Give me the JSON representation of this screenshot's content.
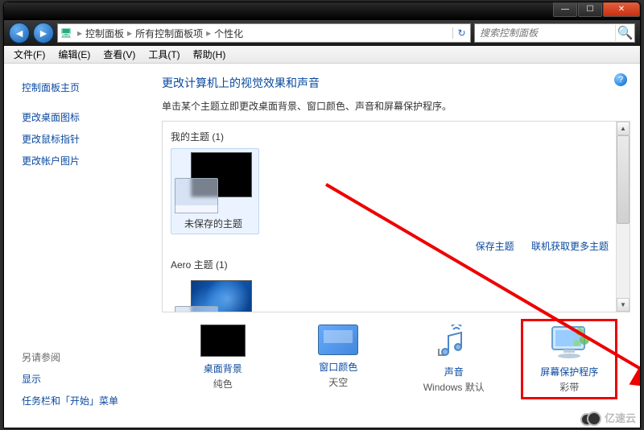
{
  "titlebar": {
    "min_glyph": "—",
    "max_glyph": "☐",
    "close_glyph": "✕"
  },
  "nav": {
    "back_glyph": "◄",
    "fwd_glyph": "►"
  },
  "breadcrumb": {
    "root": "控制面板",
    "mid": "所有控制面板项",
    "leaf": "个性化",
    "sep": "▸",
    "icon": "🖥",
    "refresh_glyph": "↻"
  },
  "search": {
    "placeholder": "搜索控制面板",
    "glyph": "🔍"
  },
  "menubar": {
    "file": "文件(F)",
    "edit": "编辑(E)",
    "view": "查看(V)",
    "tools": "工具(T)",
    "help": "帮助(H)"
  },
  "sidebar": {
    "home": "控制面板主页",
    "items": [
      "更改桌面图标",
      "更改鼠标指针",
      "更改帐户图片"
    ],
    "seealso_h": "另请参阅",
    "seealso": [
      "显示",
      "任务栏和「开始」菜单"
    ]
  },
  "main": {
    "title": "更改计算机上的视觉效果和声音",
    "desc": "单击某个主题立即更改桌面背景、窗口颜色、声音和屏幕保护程序。",
    "help_glyph": "?",
    "group_my": "我的主题 (1)",
    "theme_unsaved": "未保存的主题",
    "action_save": "保存主题",
    "action_more": "联机获取更多主题",
    "group_aero": "Aero 主题 (1)"
  },
  "bottom": {
    "bg_label": "桌面背景",
    "bg_sub": "纯色",
    "color_label": "窗口颜色",
    "color_sub": "天空",
    "sound_label": "声音",
    "sound_sub": "Windows 默认",
    "ss_label": "屏幕保护程序",
    "ss_sub": "彩带"
  },
  "watermark": "亿速云"
}
